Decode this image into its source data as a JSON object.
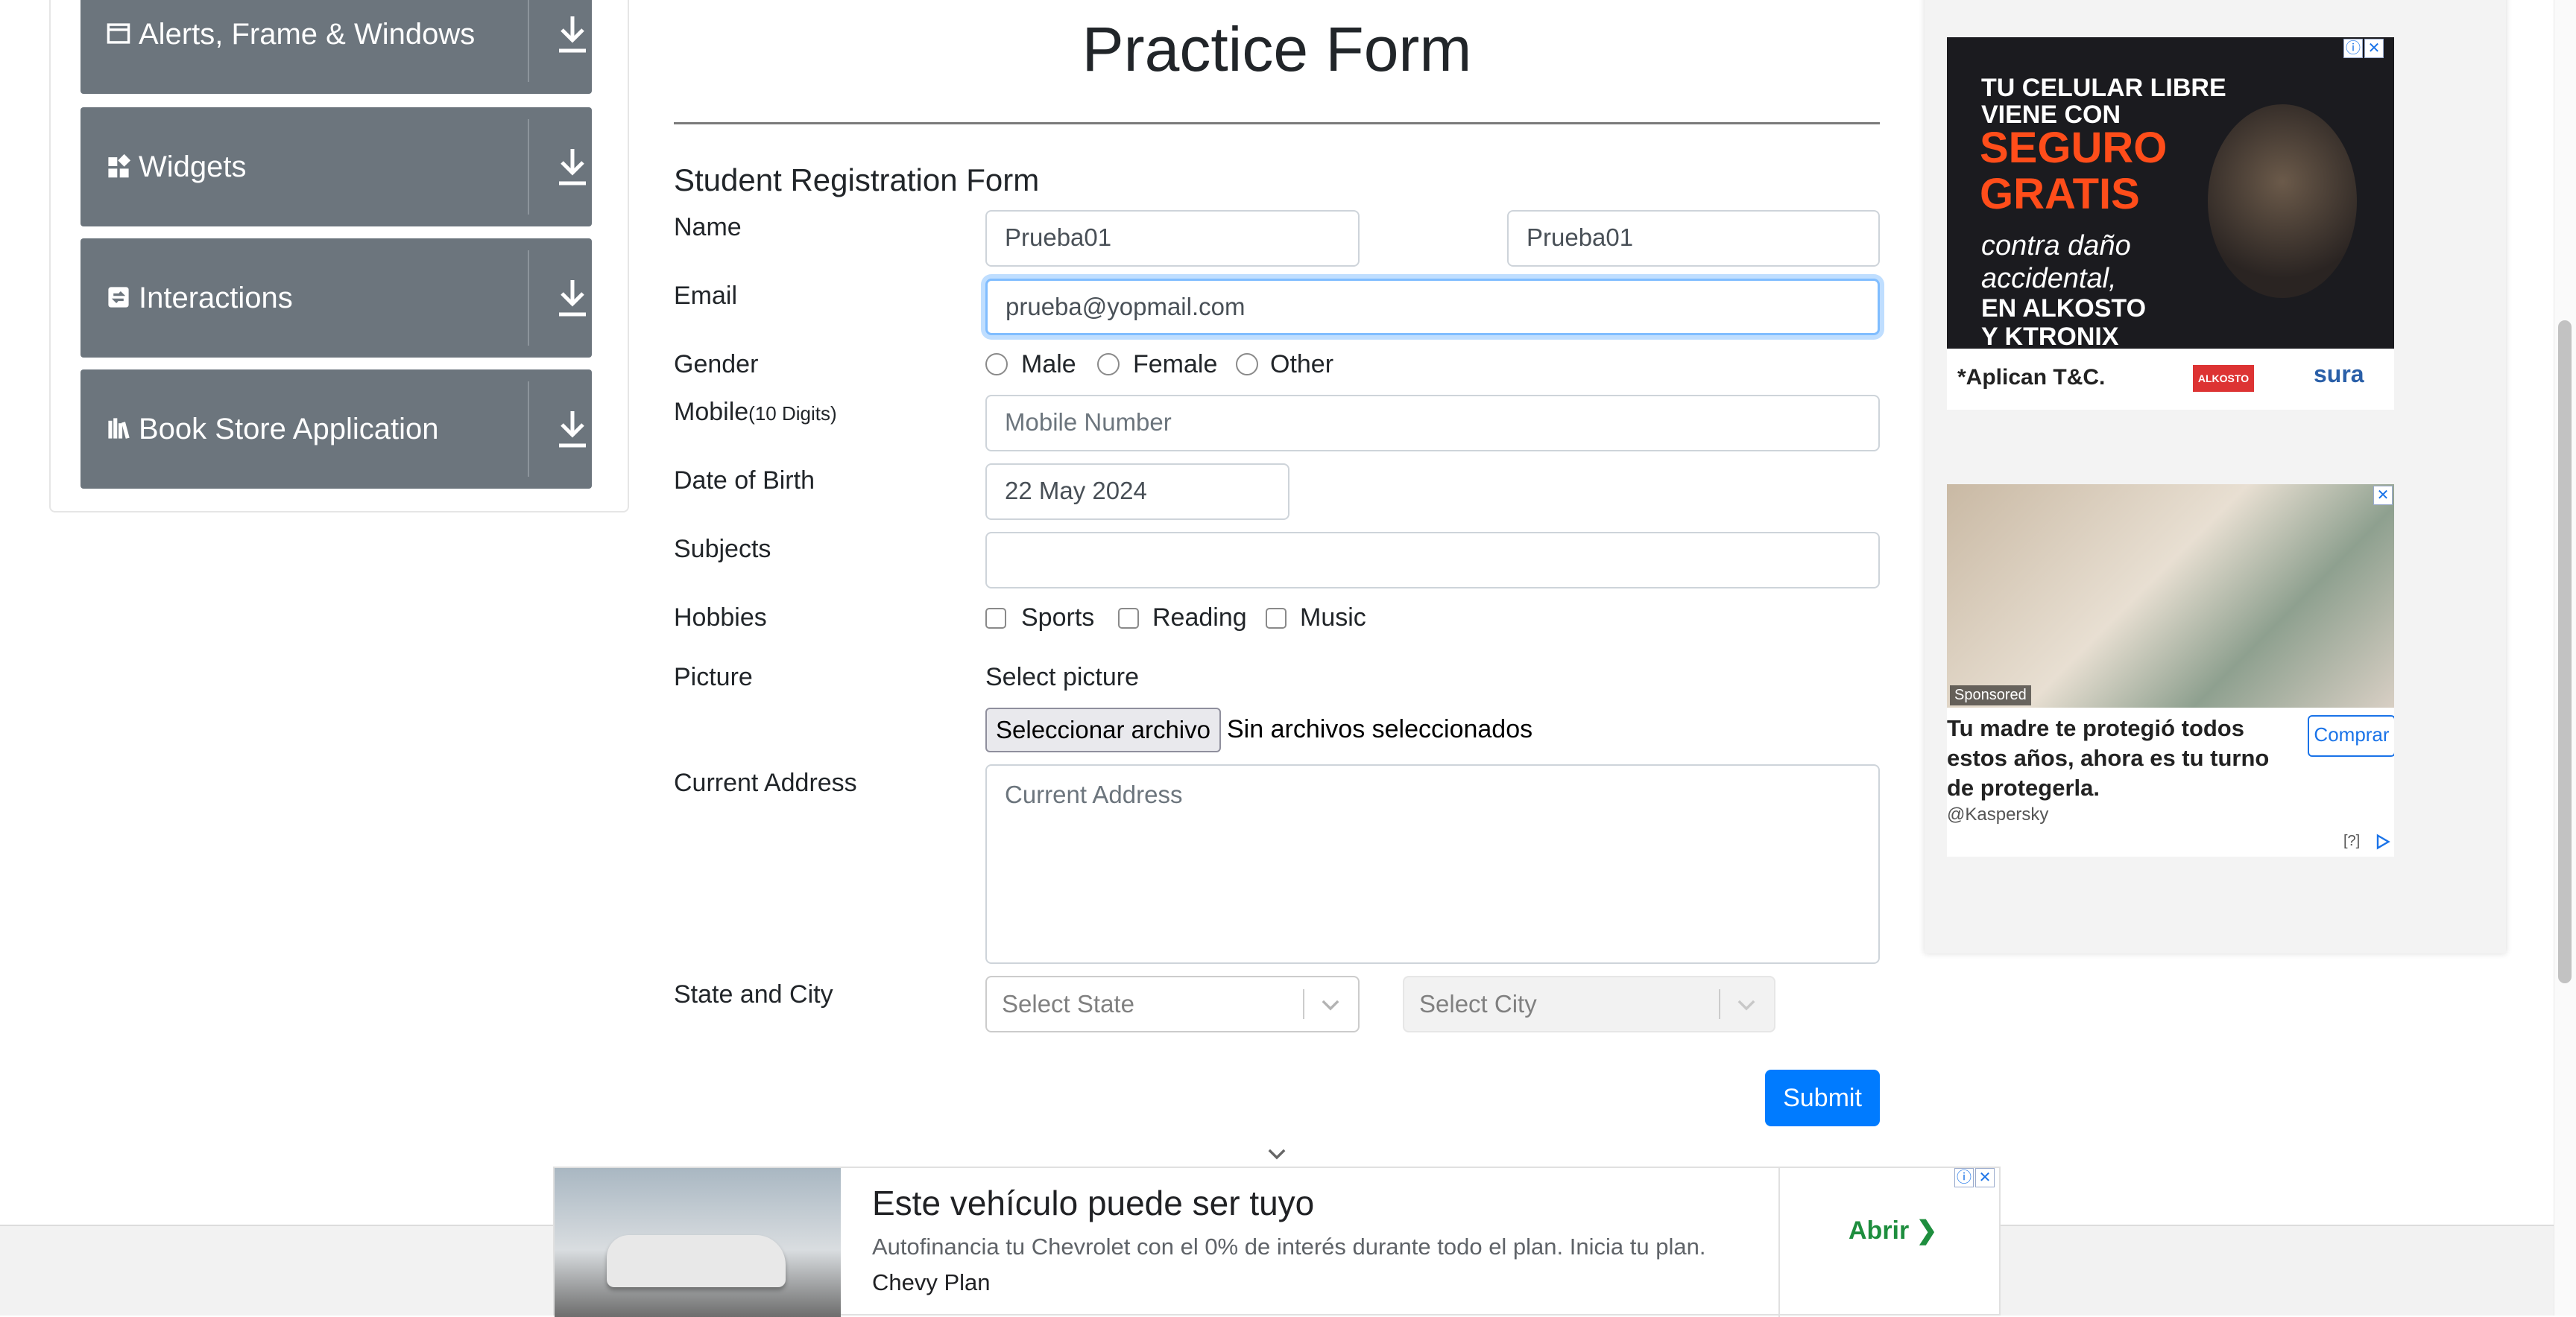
{
  "sidebar": {
    "groups": [
      {
        "label": "Alerts, Frame & Windows",
        "icon": "window-icon"
      },
      {
        "label": "Widgets",
        "icon": "widgets-icon"
      },
      {
        "label": "Interactions",
        "icon": "interactions-icon"
      },
      {
        "label": "Book Store Application",
        "icon": "bookstore-icon"
      }
    ]
  },
  "form": {
    "page_title": "Practice Form",
    "form_title": "Student Registration Form",
    "labels": {
      "name": "Name",
      "email": "Email",
      "gender": "Gender",
      "mobile": "Mobile",
      "mobile_hint": "(10 Digits)",
      "dob": "Date of Birth",
      "subjects": "Subjects",
      "hobbies": "Hobbies",
      "picture": "Picture",
      "address": "Current Address",
      "state_city": "State and City"
    },
    "first_name": "Prueba01",
    "last_name": "Prueba01",
    "email": "prueba@yopmail.com",
    "gender_options": [
      "Male",
      "Female",
      "Other"
    ],
    "mobile_placeholder": "Mobile Number",
    "dob": "22 May 2024",
    "subjects": "",
    "hobby_options": [
      "Sports",
      "Reading",
      "Music"
    ],
    "picture_caption": "Select picture",
    "file_button": "Seleccionar archivo",
    "file_status": "Sin archivos seleccionados",
    "address_placeholder": "Current Address",
    "state_placeholder": "Select State",
    "city_placeholder": "Select City",
    "submit_label": "Submit",
    "accent_color": "#007bff"
  },
  "ads": {
    "right_top": {
      "line1": "TU CELULAR LIBRE",
      "line2": "VIENE CON",
      "line3": "SEGURO",
      "line4": "GRATIS",
      "line5": "contra daño",
      "line6": "accidental,",
      "line7": "EN ALKOSTO",
      "line8": "Y KTRONIX",
      "footer_note": "*Aplican T&C.",
      "brand_a": "ALKOSTO",
      "brand_b": "sura"
    },
    "right_bottom": {
      "sponsored": "Sponsored",
      "headline": "Tu madre te protegió todos estos años, ahora es tu turno de protegerla.",
      "cta": "Comprar",
      "advertiser": "@Kaspersky",
      "help": "[?]"
    },
    "bottom": {
      "headline": "Este vehículo puede ser tuyo",
      "description": "Autofinancia tu Chevrolet con el 0% de interés durante todo el plan. Inicia tu plan.",
      "brand": "Chevy Plan",
      "cta": "Abrir"
    }
  }
}
